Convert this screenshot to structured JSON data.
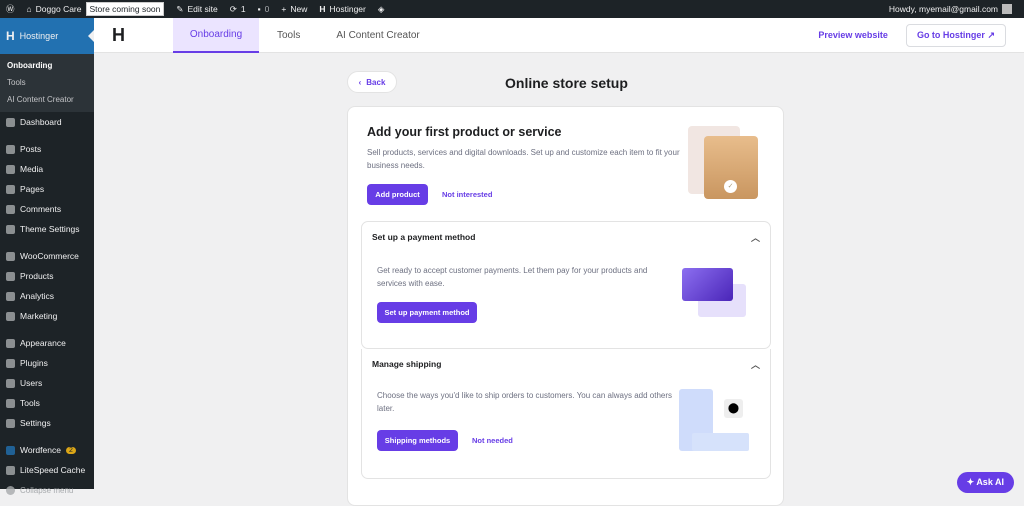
{
  "adminbar": {
    "site": "Doggo Care",
    "store_badge": "Store coming soon",
    "edit_site": "Edit site",
    "updates": "1",
    "comments": "0",
    "new": "New",
    "hostinger": "Hostinger",
    "howdy": "Howdy, myemail@gmail.com"
  },
  "sidebar": {
    "hostinger": "Hostinger",
    "sub": [
      "Onboarding",
      "Tools",
      "AI Content Creator"
    ],
    "items": [
      "Dashboard",
      "Posts",
      "Media",
      "Pages",
      "Comments",
      "Theme Settings",
      "WooCommerce",
      "Products",
      "Analytics",
      "Marketing",
      "Appearance",
      "Plugins",
      "Users",
      "Tools",
      "Settings",
      "Wordfence",
      "LiteSpeed Cache",
      "Collapse menu"
    ],
    "wordfence_badge": "2"
  },
  "topnav": {
    "tabs": [
      "Onboarding",
      "Tools",
      "AI Content Creator"
    ],
    "preview": "Preview website",
    "goto": "Go to Hostinger"
  },
  "page": {
    "back": "Back",
    "title": "Online store setup"
  },
  "product": {
    "title": "Add your first product or service",
    "desc": "Sell products, services and digital downloads. Set up and customize each item to fit your business needs.",
    "button": "Add product",
    "link": "Not interested"
  },
  "payment": {
    "title": "Set up a payment method",
    "desc": "Get ready to accept customer payments. Let them pay for your products and services with ease.",
    "button": "Set up payment method"
  },
  "shipping": {
    "title": "Manage shipping",
    "desc": "Choose the ways you'd like to ship orders to customers. You can always add others later.",
    "button": "Shipping methods",
    "link": "Not needed"
  },
  "ask_ai": "Ask AI"
}
